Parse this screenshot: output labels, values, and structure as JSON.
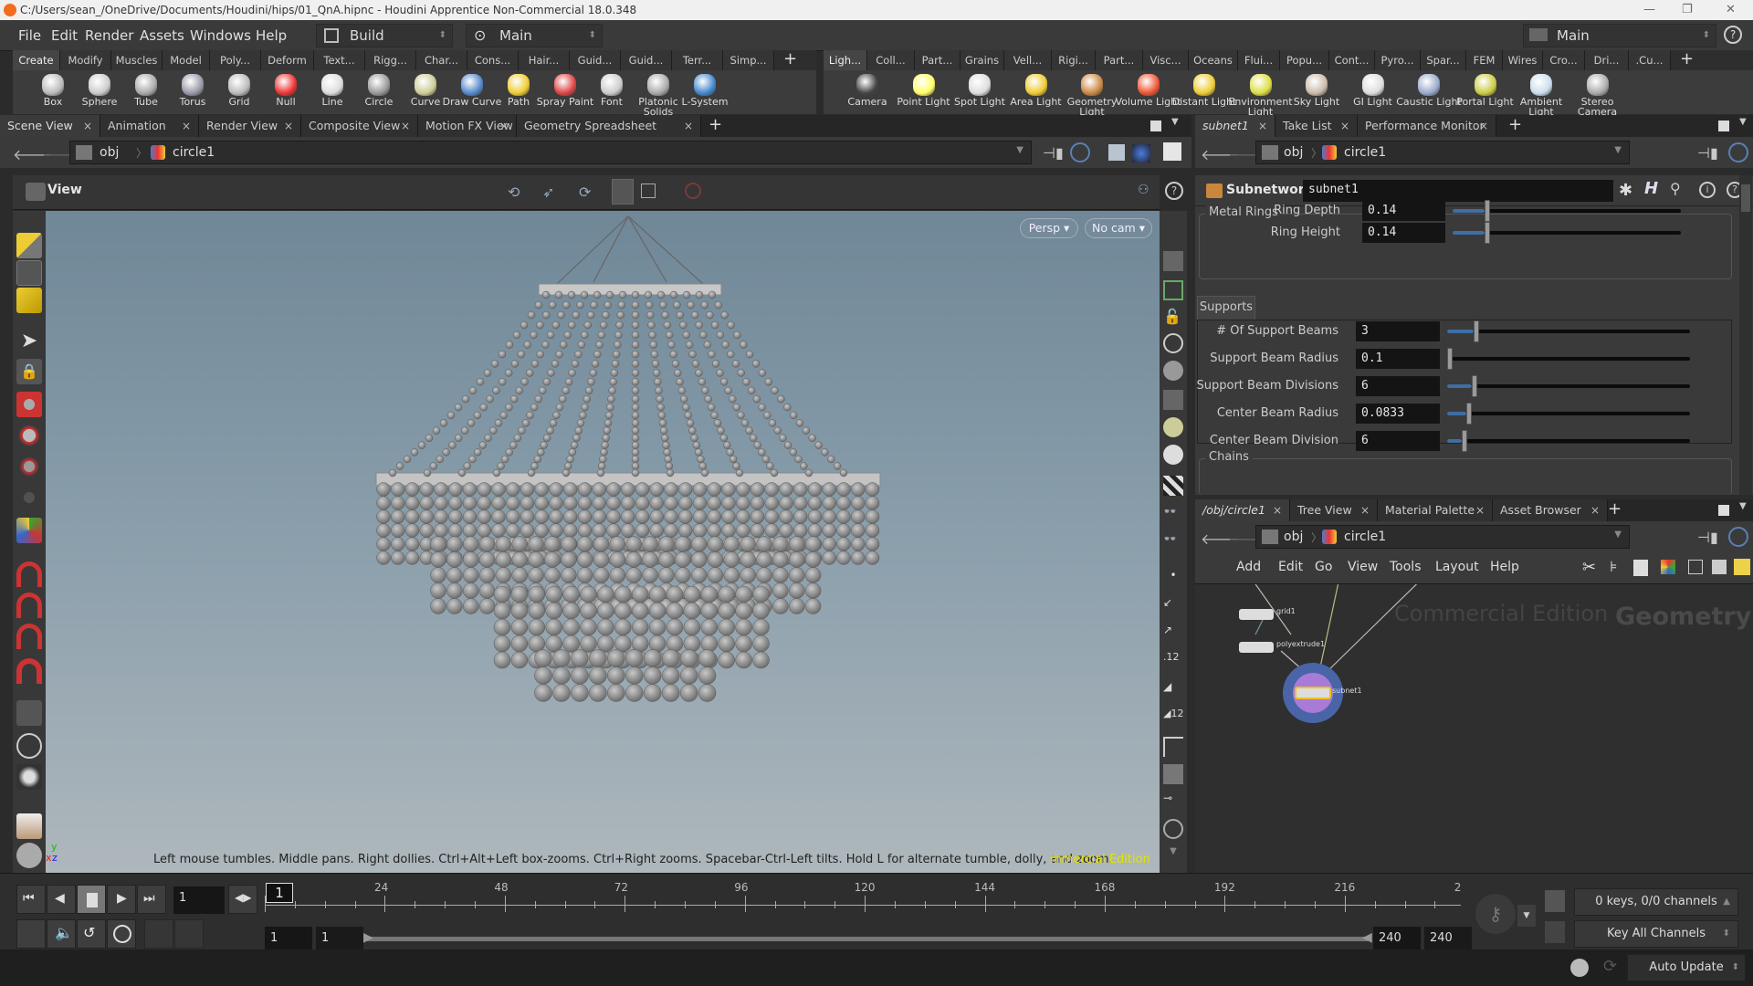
{
  "window": {
    "title": "C:/Users/sean_/OneDrive/Documents/Houdini/hips/01_QnA.hipnc - Houdini Apprentice Non-Commercial 18.0.348",
    "controls": [
      "—",
      "❐",
      "✕"
    ]
  },
  "menubar": {
    "items": [
      "File",
      "Edit",
      "Render",
      "Assets",
      "Windows",
      "Help"
    ],
    "desktop": "Build",
    "context": "Main",
    "right_context": "Main"
  },
  "shelf_left": {
    "tabs": [
      "Create",
      "Modify",
      "Muscles",
      "Model",
      "Poly...",
      "Deform",
      "Text...",
      "Rigg...",
      "Char...",
      "Cons...",
      "Hair...",
      "Guid...",
      "Guid...",
      "Terr...",
      "Simp..."
    ],
    "active_tab": "Create",
    "tools": [
      "Box",
      "Sphere",
      "Tube",
      "Torus",
      "Grid",
      "Null",
      "Line",
      "Circle",
      "Curve",
      "Draw Curve",
      "Path",
      "Spray Paint",
      "Font",
      "Platonic Solids",
      "L-System"
    ]
  },
  "shelf_right": {
    "tabs": [
      "Ligh...",
      "Coll...",
      "Part...",
      "Grains",
      "Vell...",
      "Rigi...",
      "Part...",
      "Visc...",
      "Oceans",
      "Flui...",
      "Popu...",
      "Cont...",
      "Pyro...",
      "Spar...",
      "FEM",
      "Wires",
      "Cro...",
      "Dri...",
      ".Cu..."
    ],
    "active_tab": "Ligh...",
    "tools": [
      "Camera",
      "Point Light",
      "Spot Light",
      "Area Light",
      "Geometry Light",
      "Volume Light",
      "Distant Light",
      "Environment Light",
      "Sky Light",
      "GI Light",
      "Caustic Light",
      "Portal Light",
      "Ambient Light",
      "Stereo Camera"
    ]
  },
  "scene_pane": {
    "tabs": [
      "Scene View",
      "Animation Editor",
      "Render View",
      "Composite View",
      "Motion FX View",
      "Geometry Spreadsheet"
    ],
    "active_tab": "Scene View",
    "path": [
      "obj",
      "circle1"
    ],
    "view_label": "View",
    "persp_label": "Persp",
    "cam_label": "No cam",
    "hint": "Left mouse tumbles. Middle pans. Right dollies. Ctrl+Alt+Left box-zooms. Ctrl+Right zooms. Spacebar-Ctrl-Left tilts. Hold L for alternate tumble, dolly, and zoom.",
    "watermark": "mmercial Edition",
    "axis": {
      "x": "x",
      "y": "y",
      "z": "z"
    }
  },
  "param_pane": {
    "tabs": [
      "subnet1",
      "Take List",
      "Performance Monitor"
    ],
    "active_tab": "subnet1",
    "path": [
      "obj",
      "circle1"
    ],
    "node_type": "Subnetwork",
    "node_name": "subnet1",
    "sections": {
      "metal_rings": {
        "title": "Metal Rings",
        "params": [
          {
            "label": "Ring Depth",
            "value": "0.14",
            "slider": 0.14
          },
          {
            "label": "Ring Height",
            "value": "0.14",
            "slider": 0.14
          }
        ]
      },
      "supports": {
        "title": "Supports",
        "params": [
          {
            "label": "# Of Support Beams",
            "value": "3",
            "slider": 0.11
          },
          {
            "label": "Support Beam Radius",
            "value": "0.1",
            "slider": 0.0
          },
          {
            "label": "Support Beam Divisions",
            "value": "6",
            "slider": 0.1
          },
          {
            "label": "Center Beam Radius",
            "value": "0.0833",
            "slider": 0.08
          },
          {
            "label": "Center Beam Division",
            "value": "6",
            "slider": 0.06
          }
        ]
      },
      "chains": {
        "title": "Chains"
      }
    }
  },
  "network_pane": {
    "tabs": [
      "/obj/circle1",
      "Tree View",
      "Material Palette",
      "Asset Browser"
    ],
    "active_tab": "/obj/circle1",
    "path": [
      "obj",
      "circle1"
    ],
    "menu": [
      "Add",
      "Edit",
      "Go",
      "View",
      "Tools",
      "Layout",
      "Help"
    ],
    "watermark": "Commercial Edition",
    "context_label": "Geometry",
    "nodes": [
      {
        "name": "grid1"
      },
      {
        "name": "polyextrude1"
      },
      {
        "name": "subnet1"
      }
    ]
  },
  "timeline": {
    "current_frame": "1",
    "frame_marker": "1",
    "ticks": [
      "24",
      "48",
      "72",
      "96",
      "120",
      "144",
      "168",
      "192",
      "216",
      "2"
    ],
    "range_start": "1",
    "range_start2": "1",
    "range_end": "240",
    "range_end2": "240",
    "keys_status": "0 keys, 0/0 channels",
    "key_mode": "Key All Channels"
  },
  "statusbar": {
    "update_mode": "Auto Update"
  }
}
